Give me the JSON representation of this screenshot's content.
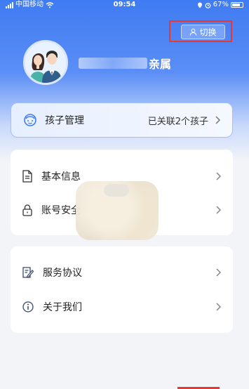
{
  "status_bar": {
    "carrier": "中国移动",
    "time": "09:54",
    "battery": "67%"
  },
  "header": {
    "switch_label": "切换",
    "name_suffix": "亲属"
  },
  "kids_card": {
    "label": "孩子管理",
    "status": "已关联2个孩子"
  },
  "settings_group_1": [
    {
      "label": "基本信息",
      "icon": "document-icon"
    },
    {
      "label": "账号安全",
      "icon": "lock-icon"
    }
  ],
  "settings_group_2": [
    {
      "label": "服务协议",
      "icon": "agreement-icon"
    },
    {
      "label": "关于我们",
      "icon": "info-icon"
    }
  ],
  "colors": {
    "accent": "#3f7bf2",
    "highlight": "#e53935"
  }
}
